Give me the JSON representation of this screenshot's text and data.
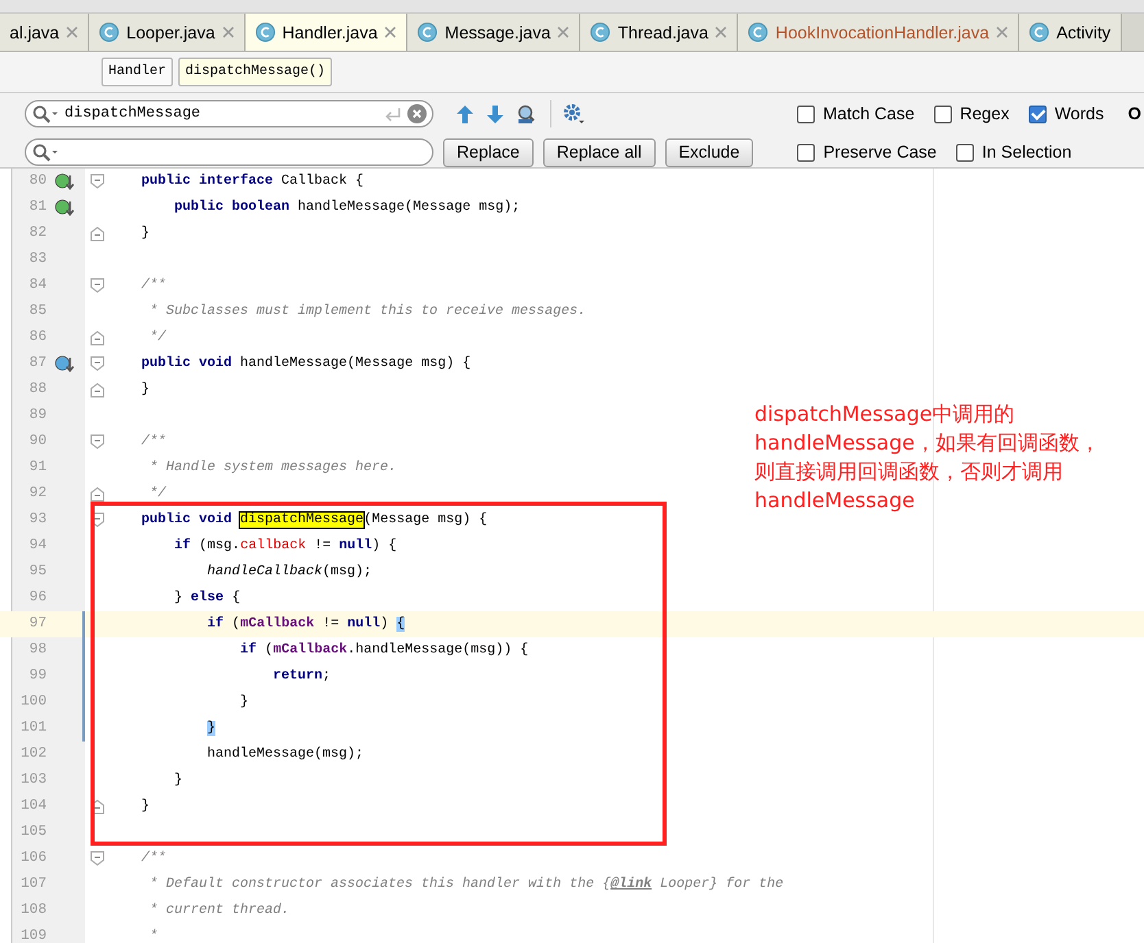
{
  "tabs": [
    {
      "label": "al.java",
      "selected": false,
      "color": "#000000"
    },
    {
      "label": "Looper.java",
      "selected": false,
      "color": "#000000"
    },
    {
      "label": "Handler.java",
      "selected": true,
      "color": "#000000"
    },
    {
      "label": "Message.java",
      "selected": false,
      "color": "#000000"
    },
    {
      "label": "Thread.java",
      "selected": false,
      "color": "#000000"
    },
    {
      "label": "HookInvocationHandler.java",
      "selected": false,
      "color": "#b4532a"
    },
    {
      "label": "Activity",
      "selected": false,
      "color": "#000000"
    }
  ],
  "breadcrumb": [
    {
      "label": "Handler",
      "selected": false
    },
    {
      "label": "dispatchMessage()",
      "selected": true
    }
  ],
  "find": {
    "search_value": "dispatchMessage",
    "buttons": [
      "Replace",
      "Replace all",
      "Exclude"
    ],
    "search_options": [
      {
        "label": "Match Case",
        "checked": false
      },
      {
        "label": "Regex",
        "checked": false
      },
      {
        "label": "Words",
        "checked": true
      }
    ],
    "replace_options": [
      {
        "label": "Preserve Case",
        "checked": false
      },
      {
        "label": "In Selection",
        "checked": false
      }
    ],
    "trailing_label": "O"
  },
  "editor": {
    "lines": [
      {
        "number": "80",
        "gutter_icon": {
          "kind": "implemented"
        },
        "fold": {
          "kind": "start"
        },
        "current": false,
        "tokens": [
          {
            "kind": "keyword",
            "text": "    public interface"
          },
          {
            "kind": "plain",
            "text": " Callback {"
          }
        ]
      },
      {
        "number": "81",
        "gutter_icon": {
          "kind": "implemented"
        },
        "current": false,
        "tokens": [
          {
            "kind": "keyword",
            "text": "        public boolean"
          },
          {
            "kind": "plain",
            "text": " handleMessage(Message msg);"
          }
        ]
      },
      {
        "number": "82",
        "fold": {
          "kind": "end"
        },
        "current": false,
        "tokens": [
          {
            "kind": "plain",
            "text": "    }"
          }
        ]
      },
      {
        "number": "83",
        "current": false
      },
      {
        "number": "84",
        "fold": {
          "kind": "start"
        },
        "current": false,
        "tokens": [
          {
            "kind": "comment",
            "text": "    /**"
          }
        ]
      },
      {
        "number": "85",
        "current": false,
        "tokens": [
          {
            "kind": "comment",
            "text": "     * Subclasses must implement this to receive messages."
          }
        ]
      },
      {
        "number": "86",
        "fold": {
          "kind": "end"
        },
        "current": false,
        "tokens": [
          {
            "kind": "comment",
            "text": "     */"
          }
        ]
      },
      {
        "number": "87",
        "gutter_icon": {
          "kind": "overridden"
        },
        "fold": {
          "kind": "start"
        },
        "current": false,
        "tokens": [
          {
            "kind": "keyword",
            "text": "    public void"
          },
          {
            "kind": "plain",
            "text": " handleMessage(Message msg) {"
          }
        ]
      },
      {
        "number": "88",
        "fold": {
          "kind": "end"
        },
        "current": false,
        "tokens": [
          {
            "kind": "plain",
            "text": "    }"
          }
        ]
      },
      {
        "number": "89",
        "current": false
      },
      {
        "number": "90",
        "fold": {
          "kind": "start"
        },
        "current": false,
        "tokens": [
          {
            "kind": "comment",
            "text": "    /**"
          }
        ]
      },
      {
        "number": "91",
        "current": false,
        "tokens": [
          {
            "kind": "comment",
            "text": "     * Handle system messages here."
          }
        ]
      },
      {
        "number": "92",
        "fold": {
          "kind": "end"
        },
        "current": false,
        "tokens": [
          {
            "kind": "comment",
            "text": "     */"
          }
        ]
      },
      {
        "number": "93",
        "fold": {
          "kind": "start"
        },
        "current": false,
        "tokens": [
          {
            "kind": "keyword",
            "text": "    public void"
          },
          {
            "kind": "match",
            "text": " dispatchMessage"
          },
          {
            "kind": "plain",
            "text": "(Message msg) {"
          }
        ]
      },
      {
        "number": "94",
        "current": false,
        "tokens": [
          {
            "kind": "keyword",
            "text": "        if"
          },
          {
            "kind": "plain",
            "text": " (msg."
          },
          {
            "kind": "field",
            "text": "callback"
          },
          {
            "kind": "plain",
            "text": " != "
          },
          {
            "kind": "keyword",
            "text": "null"
          },
          {
            "kind": "plain",
            "text": ") {"
          }
        ]
      },
      {
        "number": "95",
        "current": false,
        "tokens": [
          {
            "kind": "italic",
            "text": "            handleCallback"
          },
          {
            "kind": "plain",
            "text": "(msg);"
          }
        ]
      },
      {
        "number": "96",
        "current": false,
        "tokens": [
          {
            "kind": "plain",
            "text": "        } "
          },
          {
            "kind": "keyword",
            "text": "else"
          },
          {
            "kind": "plain",
            "text": " {"
          }
        ]
      },
      {
        "number": "97",
        "current": true,
        "changed": true,
        "tokens": [
          {
            "kind": "keyword",
            "text": "            if"
          },
          {
            "kind": "plain",
            "text": " ("
          },
          {
            "kind": "member",
            "text": "mCallback"
          },
          {
            "kind": "plain",
            "text": " != "
          },
          {
            "kind": "keyword",
            "text": "null"
          },
          {
            "kind": "plain",
            "text": ")"
          },
          {
            "kind": "brace",
            "text": " {"
          }
        ]
      },
      {
        "number": "98",
        "current": false,
        "changed": true,
        "tokens": [
          {
            "kind": "keyword",
            "text": "                if"
          },
          {
            "kind": "plain",
            "text": " ("
          },
          {
            "kind": "member",
            "text": "mCallback"
          },
          {
            "kind": "plain",
            "text": ".handleMessage(msg)) {"
          }
        ]
      },
      {
        "number": "99",
        "current": false,
        "changed": true,
        "tokens": [
          {
            "kind": "keyword",
            "text": "                    return"
          },
          {
            "kind": "plain",
            "text": ";"
          }
        ]
      },
      {
        "number": "100",
        "current": false,
        "changed": true,
        "tokens": [
          {
            "kind": "plain",
            "text": "                }"
          }
        ]
      },
      {
        "number": "101",
        "current": false,
        "changed": true,
        "tokens": [
          {
            "kind": "brace",
            "text": "            }"
          }
        ]
      },
      {
        "number": "102",
        "current": false,
        "tokens": [
          {
            "kind": "plain",
            "text": "            handleMessage(msg);"
          }
        ]
      },
      {
        "number": "103",
        "current": false,
        "tokens": [
          {
            "kind": "plain",
            "text": "        }"
          }
        ]
      },
      {
        "number": "104",
        "fold": {
          "kind": "end"
        },
        "current": false,
        "tokens": [
          {
            "kind": "plain",
            "text": "    }"
          }
        ]
      },
      {
        "number": "105",
        "current": false
      },
      {
        "number": "106",
        "fold": {
          "kind": "start"
        },
        "current": false,
        "tokens": [
          {
            "kind": "comment",
            "text": "    /**"
          }
        ]
      },
      {
        "number": "107",
        "current": false,
        "tokens": [
          {
            "kind": "comment",
            "text": "     * Default constructor associates this handler with the {"
          },
          {
            "kind": "doclink",
            "text": "@link"
          },
          {
            "kind": "comment",
            "text": " Looper} for the"
          }
        ]
      },
      {
        "number": "108",
        "current": false,
        "tokens": [
          {
            "kind": "comment",
            "text": "     * current thread."
          }
        ]
      },
      {
        "number": "109",
        "current": false,
        "tokens": [
          {
            "kind": "comment",
            "text": "     *"
          }
        ]
      }
    ]
  },
  "annotation": {
    "lines": [
      "dispatchMessage中调用的",
      "handleMessage，如果有回调函数，",
      "则直接调用回调函数，否则才调用",
      "handleMessage"
    ]
  }
}
